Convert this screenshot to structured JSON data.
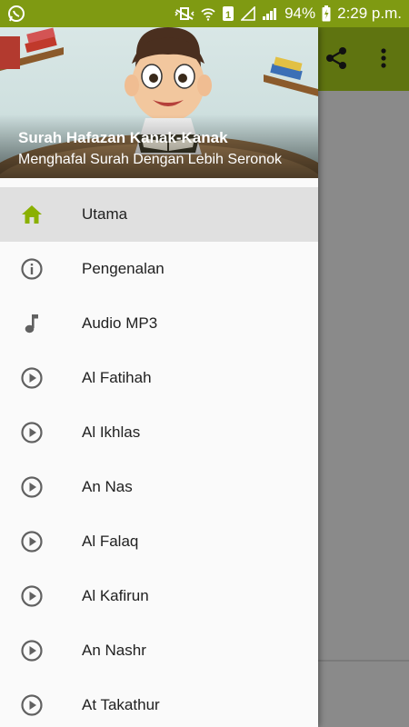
{
  "status_bar": {
    "battery": "94%",
    "time": "2:29 p.m."
  },
  "drawer": {
    "title": "Surah Hafazan Kanak-Kanak",
    "subtitle": "Menghafal Surah Dengan Lebih Seronok",
    "items": [
      {
        "label": "Utama",
        "icon": "home-icon",
        "active": true
      },
      {
        "label": "Pengenalan",
        "icon": "info-icon"
      },
      {
        "label": "Audio MP3",
        "icon": "music-note-icon"
      },
      {
        "label": "Al Fatihah",
        "icon": "play-circle-icon"
      },
      {
        "label": "Al Ikhlas",
        "icon": "play-circle-icon"
      },
      {
        "label": "An Nas",
        "icon": "play-circle-icon"
      },
      {
        "label": "Al Falaq",
        "icon": "play-circle-icon"
      },
      {
        "label": "Al Kafirun",
        "icon": "play-circle-icon"
      },
      {
        "label": "An Nashr",
        "icon": "play-circle-icon"
      },
      {
        "label": "At Takathur",
        "icon": "play-circle-icon"
      }
    ]
  },
  "colors": {
    "accent": "#8ab000",
    "status_bar": "#7f9a12",
    "toolbar": "#5f7410"
  }
}
